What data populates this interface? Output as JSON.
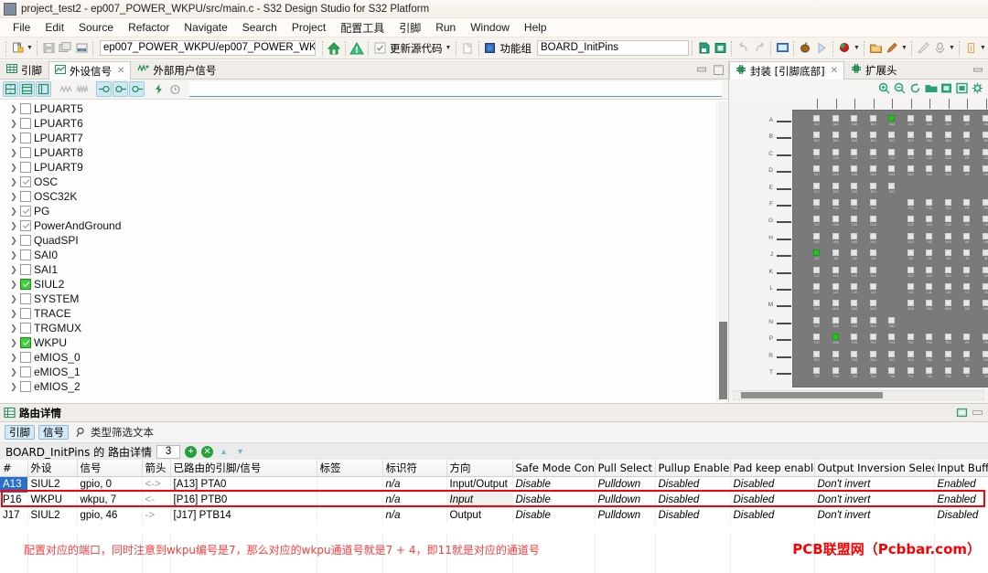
{
  "window": {
    "title": "project_test2 - ep007_POWER_WKPU/src/main.c - S32 Design Studio for S32 Platform",
    "icon": "app-icon"
  },
  "menubar": {
    "items": [
      {
        "label": "File"
      },
      {
        "label": "Edit"
      },
      {
        "label": "Source"
      },
      {
        "label": "Refactor"
      },
      {
        "label": "Navigate"
      },
      {
        "label": "Search"
      },
      {
        "label": "Project"
      },
      {
        "label": "配置工具"
      },
      {
        "label": "引脚"
      },
      {
        "label": "Run"
      },
      {
        "label": "Window"
      },
      {
        "label": "Help"
      }
    ]
  },
  "toolbar": {
    "path_value": "ep007_POWER_WKPU/ep007_POWER_WKP",
    "update_source_label": "更新源代码",
    "function_group_label": "功能组",
    "function_group_value": "BOARD_InitPins"
  },
  "left_pane": {
    "tabs": [
      {
        "label": "引脚",
        "icon": "grid-icon",
        "active": false,
        "closable": false
      },
      {
        "label": "外设信号",
        "icon": "peripheral-icon",
        "active": true,
        "closable": true
      },
      {
        "label": "外部用户信号",
        "icon": "user-signal-icon",
        "active": false,
        "closable": false
      }
    ],
    "filter_toolbar_icons": [
      "collapse-all-icon",
      "expand-all-icon",
      "show-columns-icon",
      "wave-icon",
      "wave-group-icon",
      "pin-in-icon",
      "pin-both-icon",
      "pin-out-icon",
      "power-icon",
      "clock-icon"
    ],
    "filter_placeholder": "",
    "tree": [
      {
        "label": "LPUART5",
        "state": "unchecked"
      },
      {
        "label": "LPUART6",
        "state": "unchecked"
      },
      {
        "label": "LPUART7",
        "state": "unchecked"
      },
      {
        "label": "LPUART8",
        "state": "unchecked"
      },
      {
        "label": "LPUART9",
        "state": "unchecked"
      },
      {
        "label": "OSC",
        "state": "gray"
      },
      {
        "label": "OSC32K",
        "state": "unchecked"
      },
      {
        "label": "PG",
        "state": "gray"
      },
      {
        "label": "PowerAndGround",
        "state": "gray"
      },
      {
        "label": "QuadSPI",
        "state": "unchecked"
      },
      {
        "label": "SAI0",
        "state": "unchecked"
      },
      {
        "label": "SAI1",
        "state": "unchecked"
      },
      {
        "label": "SIUL2",
        "state": "green"
      },
      {
        "label": "SYSTEM",
        "state": "unchecked"
      },
      {
        "label": "TRACE",
        "state": "unchecked"
      },
      {
        "label": "TRGMUX",
        "state": "unchecked"
      },
      {
        "label": "WKPU",
        "state": "green"
      },
      {
        "label": "eMIOS_0",
        "state": "unchecked"
      },
      {
        "label": "eMIOS_1",
        "state": "unchecked"
      },
      {
        "label": "eMIOS_2",
        "state": "unchecked"
      }
    ]
  },
  "right_pane": {
    "tabs": [
      {
        "label": "封装 [引脚底部]",
        "icon": "chip-icon",
        "active": true,
        "closable": true
      },
      {
        "label": "扩展头",
        "icon": "chip-icon",
        "active": false,
        "closable": false
      }
    ],
    "toolbar_icons": [
      "zoom-in-icon",
      "zoom-out-icon",
      "rotate-icon",
      "open-folder-icon",
      "fit-page-icon",
      "actual-size-icon",
      "settings-icon"
    ],
    "package": {
      "row_labels": [
        "A",
        "B",
        "C",
        "D",
        "E",
        "F",
        "G",
        "H",
        "J",
        "K",
        "L",
        "M",
        "N",
        "P",
        "R",
        "T"
      ],
      "columns": 11,
      "column_names": [
        "17",
        "16",
        "15",
        "14",
        "13",
        "12",
        "11",
        "10",
        "9",
        "8",
        "7"
      ],
      "highlighted_balls": [
        "A13",
        "J17",
        "P16"
      ],
      "missing": {
        "E": [
          "13",
          "12",
          "11",
          "10",
          "9",
          "8",
          "7"
        ],
        "N": [
          "13",
          "12",
          "11",
          "10",
          "9",
          "8",
          "7"
        ],
        "F": [
          "13"
        ],
        "G": [
          "13"
        ],
        "H": [
          "13"
        ],
        "J": [
          "13"
        ],
        "K": [
          "13",
          "17",
          "16",
          "15",
          "14"
        ],
        "L": [
          "13",
          "17",
          "16",
          "15",
          "14"
        ],
        "M": [
          "13",
          "17",
          "16",
          "15",
          "14"
        ],
        "K17": [],
        "L17": [],
        "M17": []
      }
    }
  },
  "bottom_panel": {
    "title": "路由详情",
    "title_icon": "routing-details-icon",
    "toggle_pin": "引脚",
    "toggle_signal": "信号",
    "filter_icon": "search-icon",
    "filter_text": "类型筛选文本",
    "subhead_label": "BOARD_InitPins 的 路由详情",
    "count": "3",
    "add_icon": "add-icon",
    "remove_icon": "remove-icon",
    "up_icon": "move-up-icon",
    "down_icon": "move-down-icon",
    "columns": [
      "#",
      "外设",
      "信号",
      "箭头",
      "已路由的引脚/信号",
      "标签",
      "标识符",
      "方向",
      "Safe Mode Control",
      "Pull Select",
      "Pullup Enable",
      "Pad keep enable",
      "Output Inversion Select",
      "Input Buffer Enable"
    ],
    "rows": [
      {
        "pin": "A13",
        "peripheral": "SIUL2",
        "signal": "gpio, 0",
        "arrow": "<->",
        "routed": "[A13] PTA0",
        "label": "",
        "identifier": "n/a",
        "direction": "Input/Output",
        "safe_mode": "Disable",
        "pull_select": "Pulldown",
        "pullup_enable": "Disabled",
        "pad_keep": "Disabled",
        "output_inversion": "Don't invert",
        "input_buffer": "Enabled",
        "selected": true,
        "highlighted": false
      },
      {
        "pin": "P16",
        "peripheral": "WKPU",
        "signal": "wkpu, 7",
        "arrow": "<-",
        "routed": "[P16] PTB0",
        "label": "",
        "identifier": "n/a",
        "direction": "Input",
        "safe_mode": "Disable",
        "pull_select": "Pulldown",
        "pullup_enable": "Disabled",
        "pad_keep": "Disabled",
        "output_inversion": "Don't invert",
        "input_buffer": "Enabled",
        "selected": false,
        "highlighted": true
      },
      {
        "pin": "J17",
        "peripheral": "SIUL2",
        "signal": "gpio, 46",
        "arrow": "->",
        "routed": "[J17] PTB14",
        "label": "",
        "identifier": "n/a",
        "direction": "Output",
        "safe_mode": "Disable",
        "pull_select": "Pulldown",
        "pullup_enable": "Disabled",
        "pad_keep": "Disabled",
        "output_inversion": "Don't invert",
        "input_buffer": "Disabled",
        "selected": false,
        "highlighted": false
      }
    ],
    "annotation": "配置对应的端口，同时注意到wkpu编号是7，那么对应的wkpu通道号就是7 + 4，即11就是对应的通道号",
    "watermark": "PCB联盟网（Pcbbar.com）"
  },
  "colors": {
    "accent_green": "#2aa44f",
    "highlight_red": "#ff0000",
    "selection_blue": "#2a6fc9",
    "checked_green": "#3cd03c",
    "annotation_red": "#ff3b3b"
  }
}
